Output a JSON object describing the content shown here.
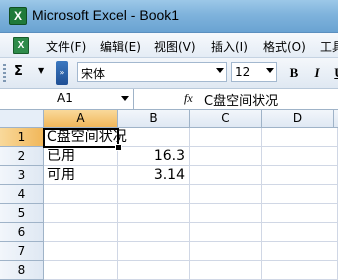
{
  "window": {
    "title": "Microsoft Excel - Book1",
    "app_icon_glyph": "X"
  },
  "menu": {
    "items": [
      "文件(F)",
      "编辑(E)",
      "视图(V)",
      "插入(I)",
      "格式(O)",
      "工具"
    ]
  },
  "toolbar": {
    "autosum_glyph": "Σ",
    "font_name": "宋体",
    "font_size": "12",
    "bold_glyph": "B",
    "italic_glyph": "I",
    "underline_glyph": "U"
  },
  "formula_bar": {
    "cell_ref": "A1",
    "fx_label": "fx",
    "formula": "C盘空间状况"
  },
  "sheet": {
    "columns": [
      "A",
      "B",
      "C",
      "D"
    ],
    "rows": [
      "1",
      "2",
      "3",
      "4",
      "5",
      "6",
      "7",
      "8"
    ],
    "cells": {
      "A1": "C盘空间状况",
      "A2": "已用",
      "B2": "16.3",
      "A3": "可用",
      "B3": "3.14"
    }
  }
}
